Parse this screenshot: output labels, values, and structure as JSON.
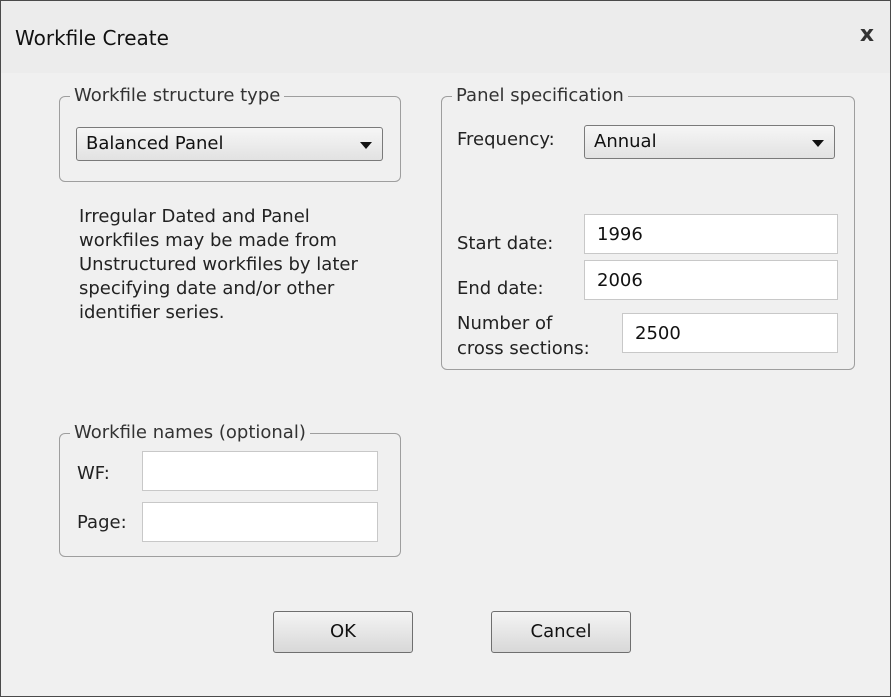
{
  "window": {
    "title": "Workfile Create",
    "close_label": "x"
  },
  "structure": {
    "group_label": "Workfile structure type",
    "selected": "Balanced Panel",
    "info": "Irregular Dated and Panel\nworkfiles may be made from\nUnstructured workfiles by later\nspecifying date and/or other\nidentifier series."
  },
  "panel": {
    "group_label": "Panel specification",
    "frequency_label": "Frequency:",
    "frequency_value": "Annual",
    "start_label": "Start date:",
    "start_value": "1996",
    "end_label": "End date:",
    "end_value": "2006",
    "cross_label_line1": "Number of",
    "cross_label_line2": "cross sections:",
    "cross_value": "2500"
  },
  "names": {
    "group_label": "Workfile names (optional)",
    "wf_label": "WF:",
    "wf_value": "",
    "page_label": "Page:",
    "page_value": ""
  },
  "buttons": {
    "ok": "OK",
    "cancel": "Cancel"
  }
}
